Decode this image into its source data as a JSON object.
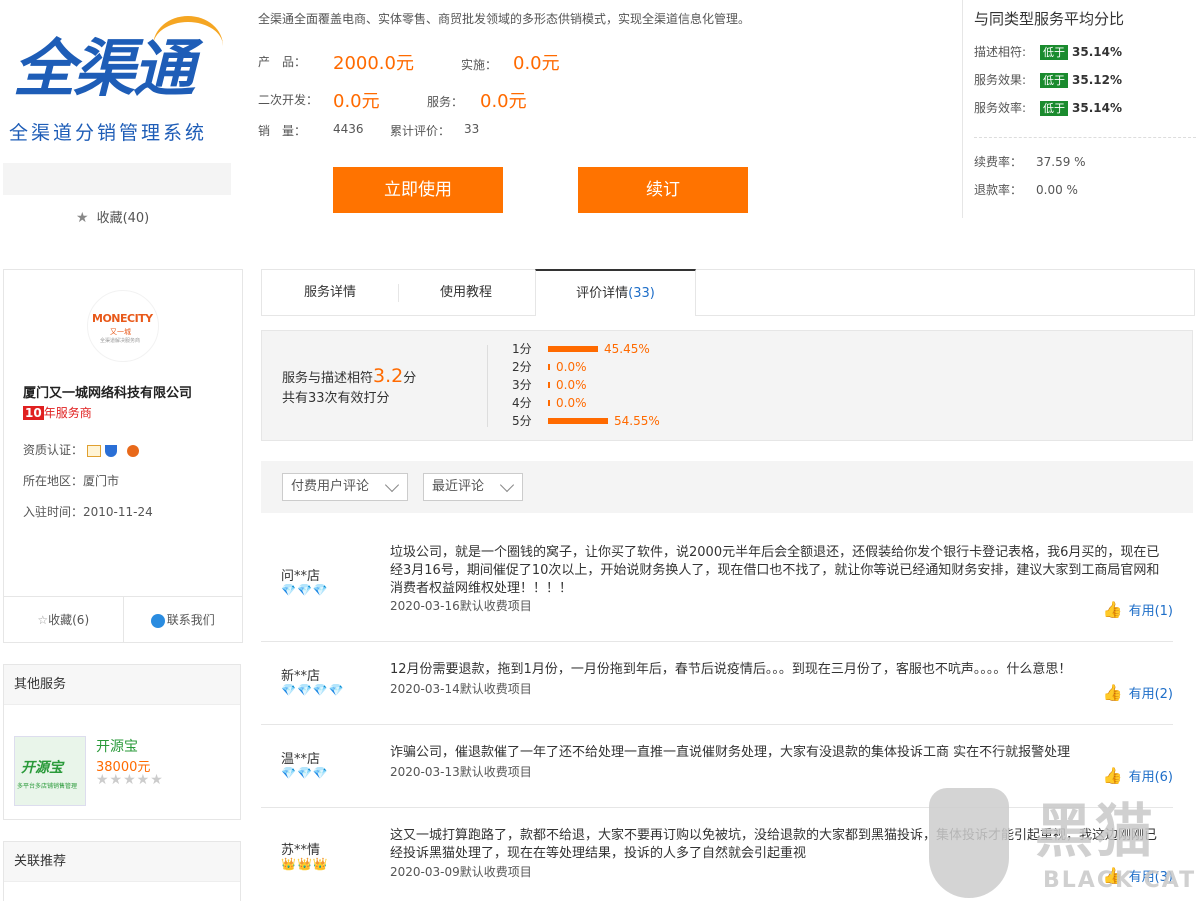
{
  "product": {
    "logo_text": "全渠通",
    "logo_subtitle": "全渠道分销管理系统",
    "favorite_label": "收藏(40)",
    "description": "全渠通全面覆盖电商、实体零售、商贸批发领域的多形态供销模式，实现全渠道信息化管理。",
    "price_label": "产　品：",
    "price_value": "2000.0元",
    "impl_label": "实施：",
    "impl_value": "0.0元",
    "dev_label": "二次开发：",
    "dev_value": "0.0元",
    "service_label": "服务：",
    "service_value": "0.0元",
    "sales_label": "销　量：",
    "sales_value": "4436",
    "rating_count_label": "累计评价：",
    "rating_count_value": "33",
    "use_button": "立即使用",
    "renew_button": "续订"
  },
  "comparison": {
    "title": "与同类型服务平均分比",
    "rows": [
      {
        "label": "描述相符:",
        "badge": "低于",
        "value": "35.14%"
      },
      {
        "label": "服务效果:",
        "badge": "低于",
        "value": "35.12%"
      },
      {
        "label": "服务效率:",
        "badge": "低于",
        "value": "35.14%"
      }
    ],
    "renewal_label": "续费率：",
    "renewal_value": "37.59 %",
    "refund_label": "退款率：",
    "refund_value": "0.00 %",
    "badge_color": "#1a8b2e"
  },
  "company": {
    "logo_text": "MONECITY",
    "logo_cn": "又一城",
    "logo_small": "全渠道解决服务商",
    "name": "厦门又一城网络科技有限公司",
    "years_num": "10",
    "years_text": "年服务商",
    "cert_label": "资质认证：",
    "region_label": "所在地区：",
    "region_value": "厦门市",
    "joined_label": "入驻时间：",
    "joined_value": "2010-11-24",
    "fav_button": "收藏(6)",
    "contact_button": "联系我们"
  },
  "sidebar": {
    "other_services_title": "其他服务",
    "other_service": {
      "name": "开源宝",
      "price": "38000元",
      "img_title": "开源宝",
      "img_caption": "多平台多店铺销售管理"
    },
    "related_title": "关联推荐"
  },
  "tabs": [
    {
      "label": "服务详情"
    },
    {
      "label": "使用教程"
    },
    {
      "label": "评价详情",
      "count": "(33)"
    }
  ],
  "score": {
    "main_prefix": "服务与描述相符",
    "main_score": "3.2",
    "main_suffix": "分",
    "sub": "共有33次有效打分",
    "distribution": [
      {
        "label": "1分",
        "pct": 45.45,
        "text": "45.45%"
      },
      {
        "label": "2分",
        "pct": 0.0,
        "text": "0.0%"
      },
      {
        "label": "3分",
        "pct": 0.0,
        "text": "0.0%"
      },
      {
        "label": "4分",
        "pct": 0.0,
        "text": "0.0%"
      },
      {
        "label": "5分",
        "pct": 54.55,
        "text": "54.55%"
      }
    ],
    "accent_color": "#ff6a00"
  },
  "filters": {
    "type": "付费用户评论",
    "sort": "最近评论"
  },
  "reviews": [
    {
      "user": "问**店",
      "gems": "💎💎💎",
      "text": "垃圾公司，就是一个圈钱的窝子，让你买了软件，说2000元半年后会全额退还，还假装给你发个银行卡登记表格，我6月买的，现在已经3月16号，期间催促了10次以上，开始说财务换人了，现在借口也不找了，就让你等说已经通知财务安排，建议大家到工商局官网和消费者权益网维权处理！！！！",
      "date": "2020-03-16默认收费项目",
      "useful": "有用(1)"
    },
    {
      "user": "新**店",
      "gems": "💎💎💎💎",
      "text": "12月份需要退款，拖到1月份，一月份拖到年后，春节后说疫情后。。。到现在三月份了，客服也不吭声。。。。什么意思！",
      "date": "2020-03-14默认收费项目",
      "useful": "有用(2)"
    },
    {
      "user": "温**店",
      "gems": "💎💎💎",
      "text": "诈骗公司，催退款催了一年了还不给处理一直推一直说催财务处理，大家有没退款的集体投诉工商 实在不行就报警处理",
      "date": "2020-03-13默认收费项目",
      "useful": "有用(6)"
    },
    {
      "user": "苏**情",
      "gems": "👑👑👑",
      "text": "这又一城打算跑路了，款都不给退，大家不要再订购以免被坑，没给退款的大家都到黑猫投诉，集体投诉才能引起重视，我这边刚刚已经投诉黑猫处理了，现在在等处理结果，投诉的人多了自然就会引起重视",
      "date": "2020-03-09默认收费项目",
      "useful": "有用(3)"
    }
  ],
  "watermark": {
    "cn": "黑猫",
    "en": "BLACK CAT"
  }
}
